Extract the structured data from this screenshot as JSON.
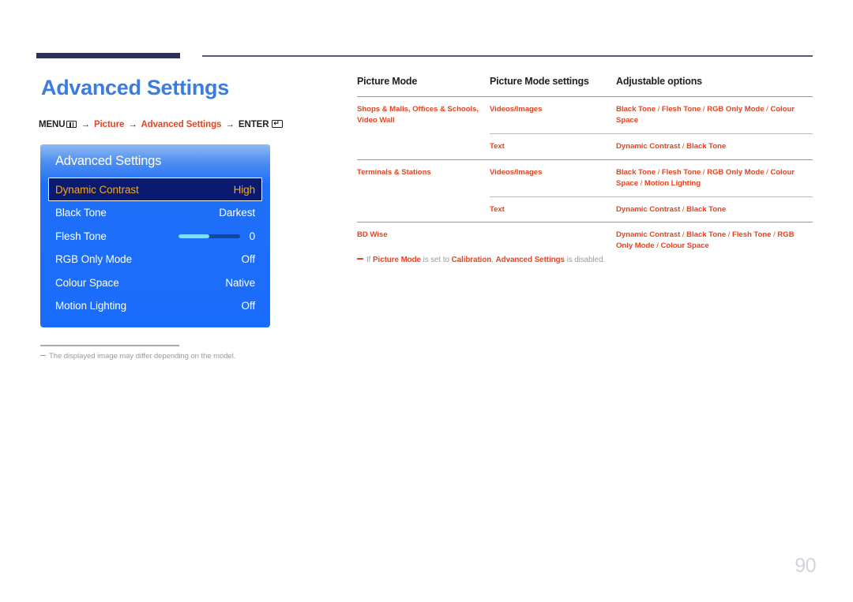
{
  "page": {
    "number": "90",
    "title": "Advanced Settings"
  },
  "breadcrumb": {
    "menu_label": "MENU",
    "menu_icon": "menu-grid-icon",
    "step_picture": "Picture",
    "step_advanced": "Advanced Settings",
    "enter_label": "ENTER",
    "enter_icon": "enter-key-icon",
    "arrow": "→"
  },
  "osd": {
    "title": "Advanced Settings",
    "rows": [
      {
        "label": "Dynamic Contrast",
        "value": "High",
        "selected": true,
        "type": "value"
      },
      {
        "label": "Black Tone",
        "value": "Darkest",
        "selected": false,
        "type": "value"
      },
      {
        "label": "Flesh Tone",
        "value": "0",
        "selected": false,
        "type": "slider",
        "slider_percent": 50
      },
      {
        "label": "RGB Only Mode",
        "value": "Off",
        "selected": false,
        "type": "value"
      },
      {
        "label": "Colour Space",
        "value": "Native",
        "selected": false,
        "type": "value"
      },
      {
        "label": "Motion Lighting",
        "value": "Off",
        "selected": false,
        "type": "value"
      }
    ],
    "colors": {
      "panel_blue": "#1a6cfb",
      "selected_bg": "#0a1a6e",
      "selected_text": "#f5a81c",
      "slider_fill": "#7fe2e8",
      "slider_track": "#16469e"
    }
  },
  "image_note": "The displayed image may differ depending on the model.",
  "table": {
    "headers": [
      "Picture Mode",
      "Picture Mode settings",
      "Adjustable options"
    ],
    "rows": [
      {
        "picture_mode": "Shops & Malls, Offices & Schools, Video Wall",
        "settings": "Videos/Images",
        "options": "Black Tone / Flesh Tone / RGB Only Mode / Colour Space",
        "divider": "full"
      },
      {
        "picture_mode": "",
        "settings": "Text",
        "options": "Dynamic Contrast / Black Tone",
        "divider": "partial"
      },
      {
        "picture_mode": "Terminals & Stations",
        "settings": "Videos/Images",
        "options": "Black Tone / Flesh Tone / RGB Only Mode / Colour Space / Motion Lighting",
        "divider": "full"
      },
      {
        "picture_mode": "",
        "settings": "Text",
        "options": "Dynamic Contrast / Black Tone",
        "divider": "partial"
      },
      {
        "picture_mode": "BD Wise",
        "settings": "",
        "options": "Dynamic Contrast / Black Tone / Flesh Tone / RGB Only Mode / Colour Space",
        "divider": "full"
      }
    ]
  },
  "table_note": {
    "part1": "If ",
    "bold1": "Picture Mode",
    "part2": " is set to ",
    "bold2": "Calibration",
    "part3": ", ",
    "bold3": "Advanced Settings",
    "part4": " is disabled."
  },
  "colors": {
    "accent_red": "#e8431f",
    "title_blue": "#3b7ce0",
    "rule_navy": "#2e3155",
    "muted_gray": "#9a9aa6"
  }
}
